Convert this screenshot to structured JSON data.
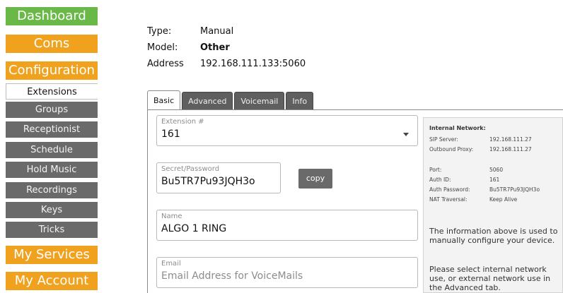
{
  "sidebar": {
    "dashboard": "Dashboard",
    "coms": "Coms",
    "configuration": "Configuration",
    "sub_items": [
      "Extensions",
      "Groups",
      "Receptionist",
      "Schedule",
      "Hold Music",
      "Recordings",
      "Keys",
      "Tricks"
    ],
    "my_services": "My Services",
    "my_account": "My Account"
  },
  "info": {
    "type_label": "Type:",
    "type_value": "Manual",
    "model_label": "Model:",
    "model_value": "Other",
    "address_label": "Address",
    "address_value": "192.168.111.133:5060"
  },
  "tabs": [
    "Basic",
    "Advanced",
    "Voicemail",
    "Info"
  ],
  "form": {
    "extension_label": "Extension #",
    "extension_value": "161",
    "secret_label": "Secret/Password",
    "secret_value": "Bu5TR7Pu93JQH3o",
    "copy_label": "copy",
    "name_label": "Name",
    "name_value": "ALGO 1 RING",
    "email_label": "Email",
    "email_placeholder": "Email Address for VoiceMails"
  },
  "network": {
    "title": "Internal Network:",
    "sip_server_label": "SIP Server:",
    "sip_server_value": "192.168.111.27",
    "outbound_proxy_label": "Outbound Proxy:",
    "outbound_proxy_value": "192.168.111.27",
    "port_label": "Port:",
    "port_value": "5060",
    "auth_id_label": "Auth ID:",
    "auth_id_value": "161",
    "auth_password_label": "Auth Password:",
    "auth_password_value": "Bu5TR7Pu93JQH3o",
    "nat_label": "NAT Traversal:",
    "nat_value": "Keep Alive",
    "note1": "The information above is used to manually configure your device.",
    "note2": "Please select internal network use, or external network use in the Advanced tab."
  },
  "colors": {
    "green": "#6ab847",
    "orange": "#f0a21e",
    "sub_gray": "#6a6a6a"
  }
}
